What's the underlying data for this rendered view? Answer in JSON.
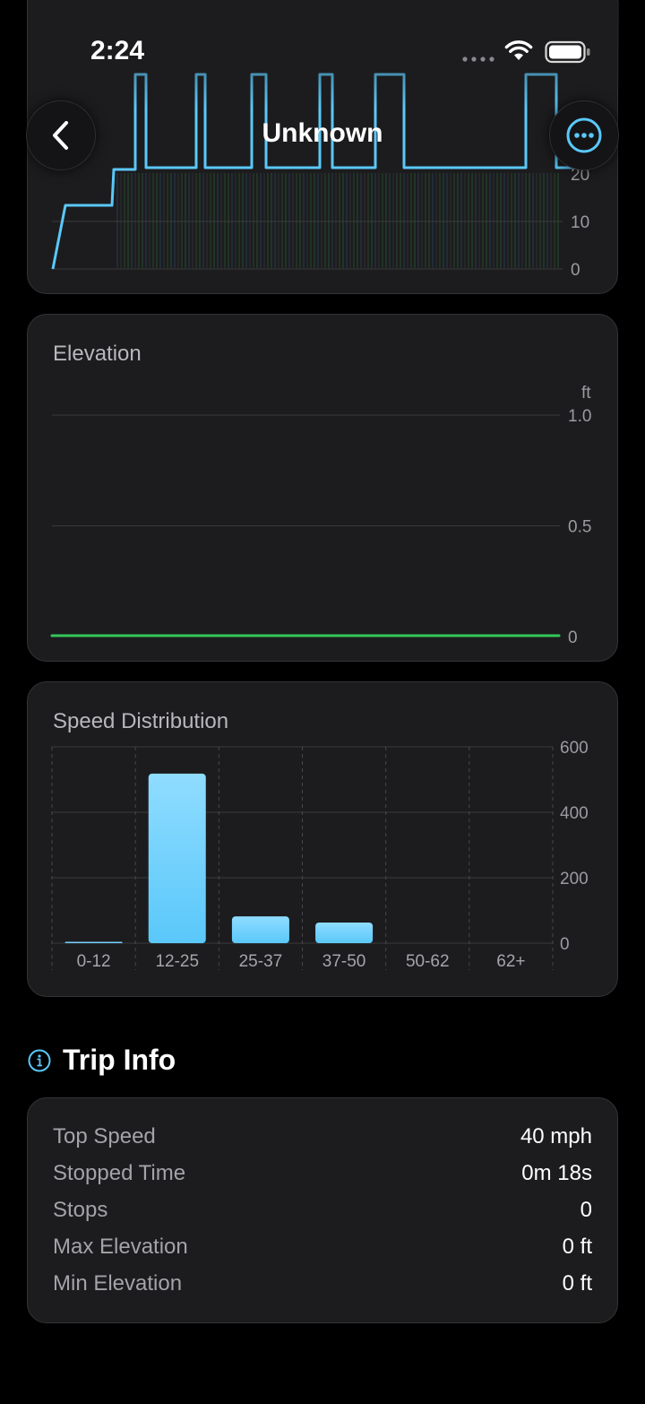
{
  "status_bar": {
    "time": "2:24"
  },
  "nav": {
    "title": "Unknown"
  },
  "speed_chart_partial": {
    "y_ticks": [
      "20",
      "10",
      "0"
    ]
  },
  "elevation": {
    "title": "Elevation",
    "unit": "ft",
    "y_ticks": [
      "1.0",
      "0.5",
      "0"
    ],
    "line_color": "#34c759"
  },
  "speed_distribution": {
    "title": "Speed Distribution",
    "bar_color": "#5ac8fa"
  },
  "trip_info": {
    "title": "Trip Info",
    "rows": [
      {
        "label": "Top Speed",
        "value": "40 mph"
      },
      {
        "label": "Stopped Time",
        "value": "0m 18s"
      },
      {
        "label": "Stops",
        "value": "0"
      },
      {
        "label": "Max Elevation",
        "value": "0 ft"
      },
      {
        "label": "Min Elevation",
        "value": "0 ft"
      }
    ]
  },
  "chart_data": [
    {
      "type": "line",
      "title": "Elevation",
      "ylabel": "ft",
      "ylim": [
        0,
        1.0
      ],
      "y_ticks": [
        0,
        0.5,
        1.0
      ],
      "series": [
        {
          "values": [
            0,
            0
          ]
        }
      ],
      "grid": true
    },
    {
      "type": "bar",
      "title": "Speed Distribution",
      "categories": [
        "0-12",
        "12-25",
        "25-37",
        "37-50",
        "50-62",
        "62+"
      ],
      "values": [
        2,
        518,
        82,
        63,
        0,
        0
      ],
      "ylim": [
        0,
        600
      ],
      "y_ticks": [
        0,
        200,
        400,
        600
      ],
      "grid": true
    }
  ]
}
